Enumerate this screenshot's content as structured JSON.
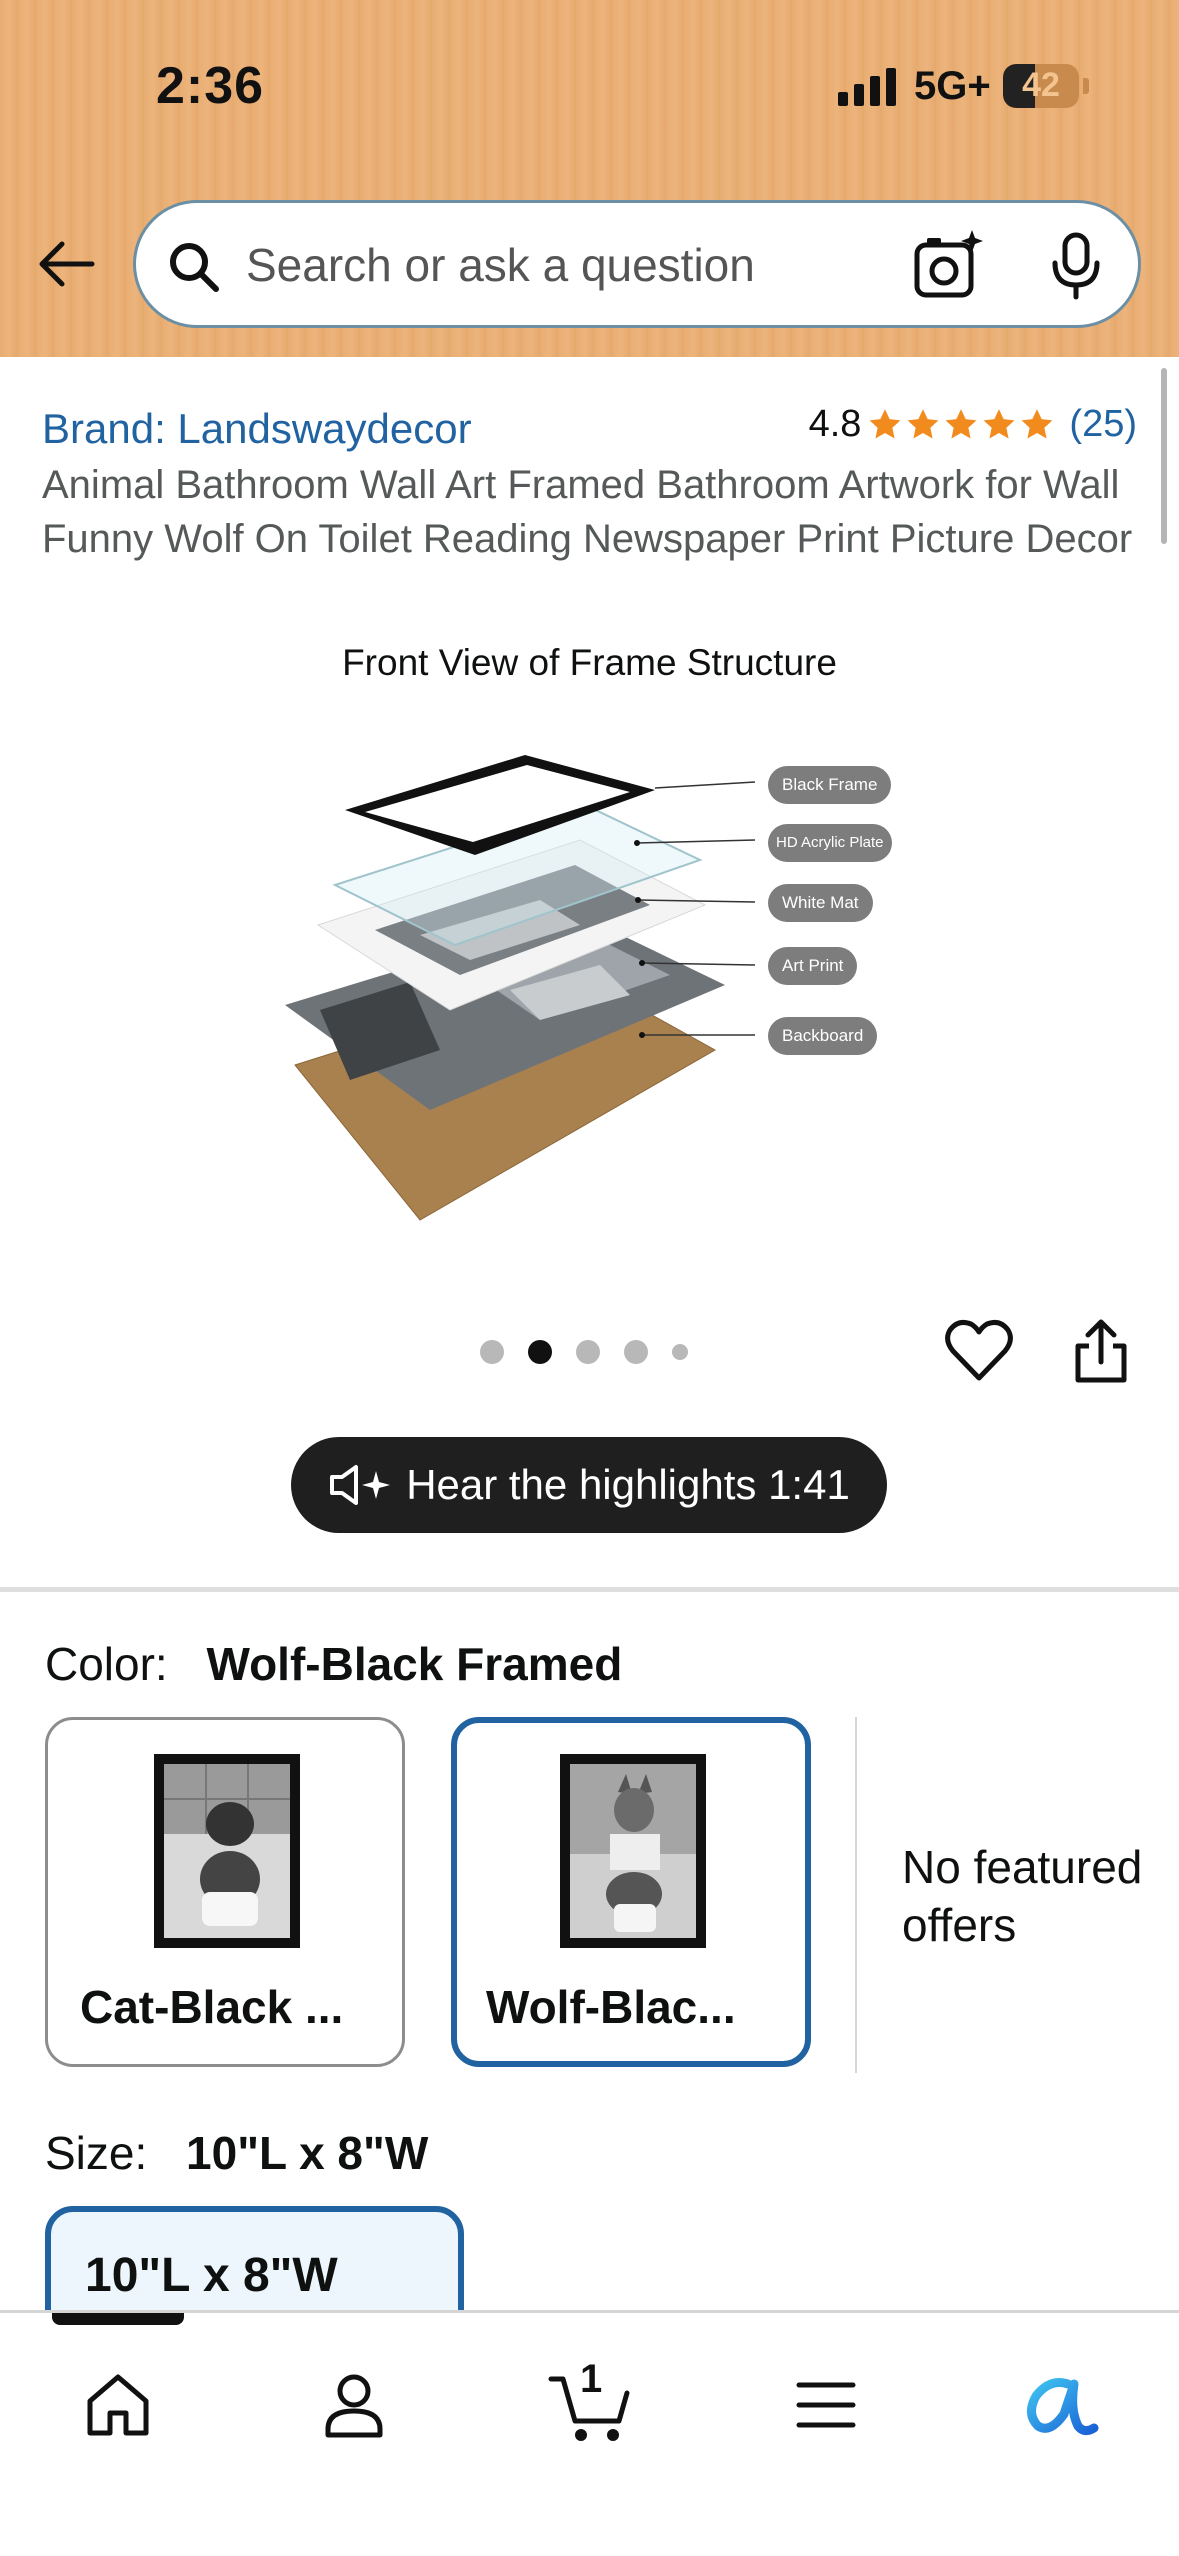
{
  "status_bar": {
    "time": "2:36",
    "network": "5G+",
    "battery": "42",
    "battery_level": 0.42
  },
  "search": {
    "placeholder": "Search or ask a question"
  },
  "product": {
    "brand": "Brand: Landswaydecor",
    "rating": "4.8",
    "stars": 5,
    "rating_count": "(25)",
    "title": "Animal Bathroom Wall Art Framed Bathroom Artwork for Wall Funny Wolf On Toilet Reading Newspaper Print Picture Decor"
  },
  "image": {
    "caption": "Front View of Frame Structure",
    "labels": [
      "Black Frame",
      "HD Acrylic Plate",
      "White Mat",
      "Art Print",
      "Backboard"
    ],
    "carousel": {
      "count": 5,
      "active_index": 1
    }
  },
  "hear_highlights": {
    "label": "Hear the highlights 1:41"
  },
  "color": {
    "label": "Color:",
    "selected": "Wolf-Black Framed",
    "options": [
      {
        "label": "Cat-Black ...",
        "selected": false
      },
      {
        "label": "Wolf-Blac...",
        "selected": true
      }
    ],
    "no_offers": "No featured offers"
  },
  "size": {
    "label": "Size:",
    "selected": "10\"L x 8\"W",
    "option": "10\"L x 8\"W"
  },
  "bottom_nav": {
    "cart_count": "1",
    "items": [
      "home-icon",
      "account-icon",
      "cart-icon",
      "menu-icon",
      "rufus-icon"
    ]
  },
  "colors": {
    "link": "#2162a1",
    "star": "#f28b1e",
    "header": "#e8ad72",
    "selected_border": "#2162a1"
  }
}
